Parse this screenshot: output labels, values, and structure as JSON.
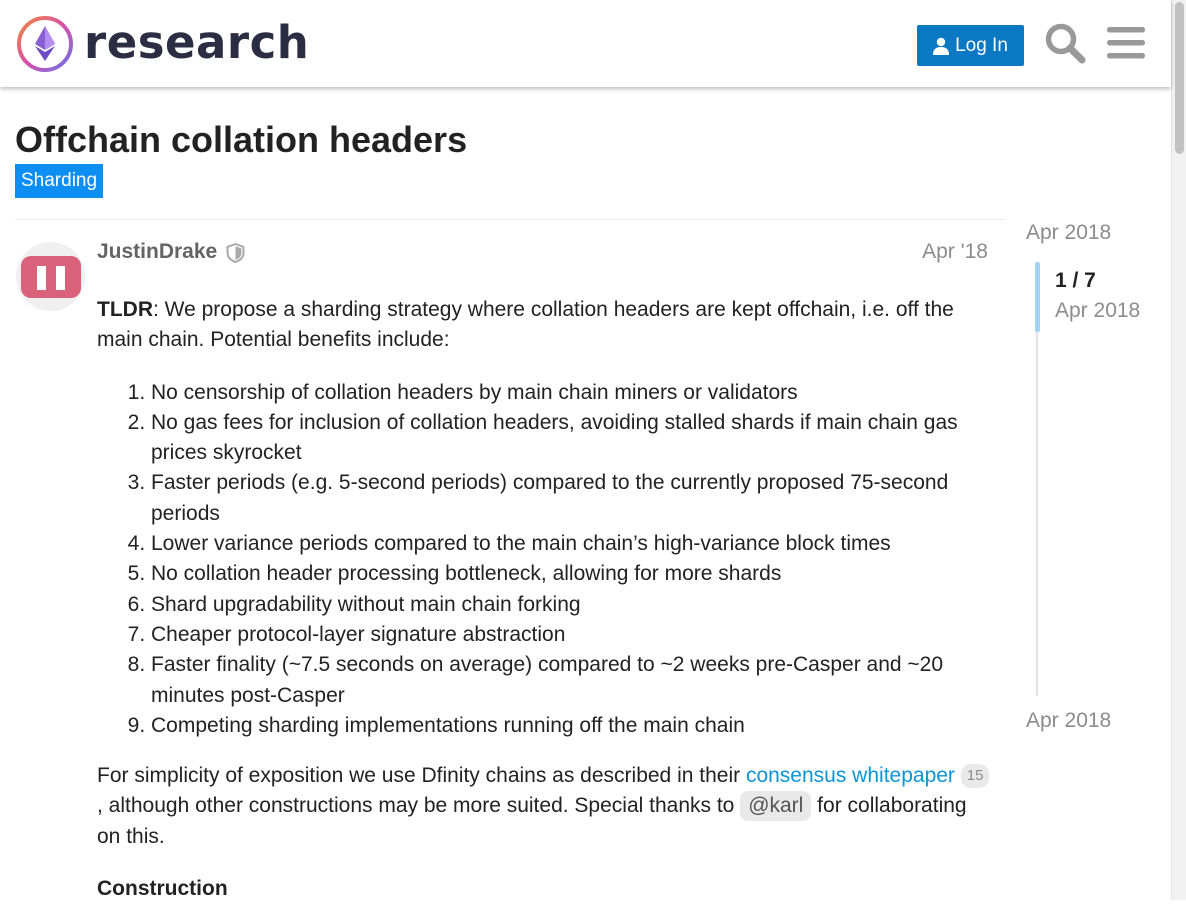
{
  "header": {
    "site_name": "research",
    "login_label": "Log In"
  },
  "icons": {
    "logo": "ethereum-logo",
    "login": "user-icon",
    "search": "search-icon",
    "menu": "hamburger-menu-icon",
    "staff": "shield-icon"
  },
  "colors": {
    "accent": "#0a78c3",
    "category": "#0d8ef2",
    "link": "#0a95d9",
    "timeline_handle": "#a3d4f5"
  },
  "topic": {
    "title": "Offchain collation headers",
    "category": "Sharding"
  },
  "post": {
    "username": "JustinDrake",
    "date": "Apr '18",
    "intro_bold": "TLDR",
    "intro_text": ": We propose a sharding strategy where collation headers are kept offchain, i.e. off the main chain. Potential benefits include:",
    "benefits": [
      "No censorship of collation headers by main chain miners or validators",
      "No gas fees for inclusion of collation headers, avoiding stalled shards if main chain gas prices skyrocket",
      "Faster periods (e.g. 5-second periods) compared to the currently proposed 75-second periods",
      "Lower variance periods compared to the main chain’s high-variance block times",
      "No collation header processing bottleneck, allowing for more shards",
      "Shard upgradability without main chain forking",
      "Cheaper protocol-layer signature abstraction",
      "Faster finality (~7.5 seconds on average) compared to ~2 weeks pre-Casper and ~20 minutes post-Casper",
      "Competing sharding implementations running off the main chain"
    ],
    "para2_start": "For simplicity of exposition we use Dfinity chains as described in their ",
    "para2_link": "consensus whitepaper",
    "para2_link_count": "15",
    "para2_middle": ", although other constructions may be more suited. Special thanks to ",
    "para2_mention": "@karl",
    "para2_end": " for collaborating on this.",
    "section_heading": "Construction"
  },
  "timeline": {
    "start_date": "Apr 2018",
    "position": "1 / 7",
    "current_date": "Apr 2018",
    "end_date": "Apr 2018",
    "progress": 0.14
  }
}
